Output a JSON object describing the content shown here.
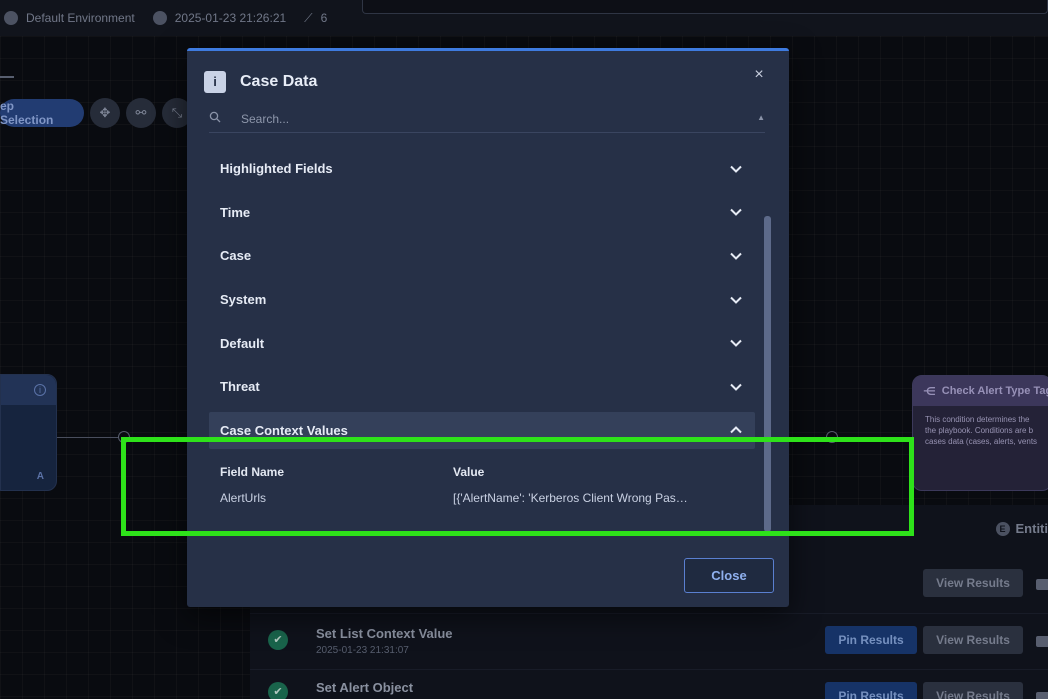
{
  "topbar": {
    "environment": "Default Environment",
    "timestamp": "2025-01-23 21:26:21",
    "steps_count": "6"
  },
  "toolbar": {
    "step_selection_label": "ep Selection"
  },
  "right_node": {
    "title": "Check Alert Type Tag",
    "description": "This condition determines the the playbook. Conditions are b cases data (cases, alerts, vents"
  },
  "left_node": {
    "badge": "A"
  },
  "results": {
    "entities_label": "Entiti",
    "rows": [
      {
        "title": "",
        "time": "",
        "view_label": "View Results"
      },
      {
        "title": "Set List Context Value",
        "time": "2025-01-23 21:31:07",
        "pin_label": "Pin Results",
        "view_label": "View Results"
      },
      {
        "title": "Set Alert Object",
        "time": "",
        "pin_label": "Pin Results",
        "view_label": "View Results"
      }
    ]
  },
  "modal": {
    "title": "Case Data",
    "search_placeholder": "Search...",
    "sections": [
      {
        "label": "Highlighted Fields",
        "expanded": false
      },
      {
        "label": "Time",
        "expanded": false
      },
      {
        "label": "Case",
        "expanded": false
      },
      {
        "label": "System",
        "expanded": false
      },
      {
        "label": "Default",
        "expanded": false
      },
      {
        "label": "Threat",
        "expanded": false
      },
      {
        "label": "Case Context Values",
        "expanded": true
      }
    ],
    "context_table": {
      "headers": [
        "Field Name",
        "Value"
      ],
      "rows": [
        {
          "field": "AlertUrls",
          "value": "[{'AlertName': 'Kerberos Client Wrong Pas…"
        }
      ]
    },
    "close_label": "Close"
  },
  "colors": {
    "accent": "#3e7be0",
    "highlight": "#2ee21a",
    "modal_bg": "#263047"
  }
}
